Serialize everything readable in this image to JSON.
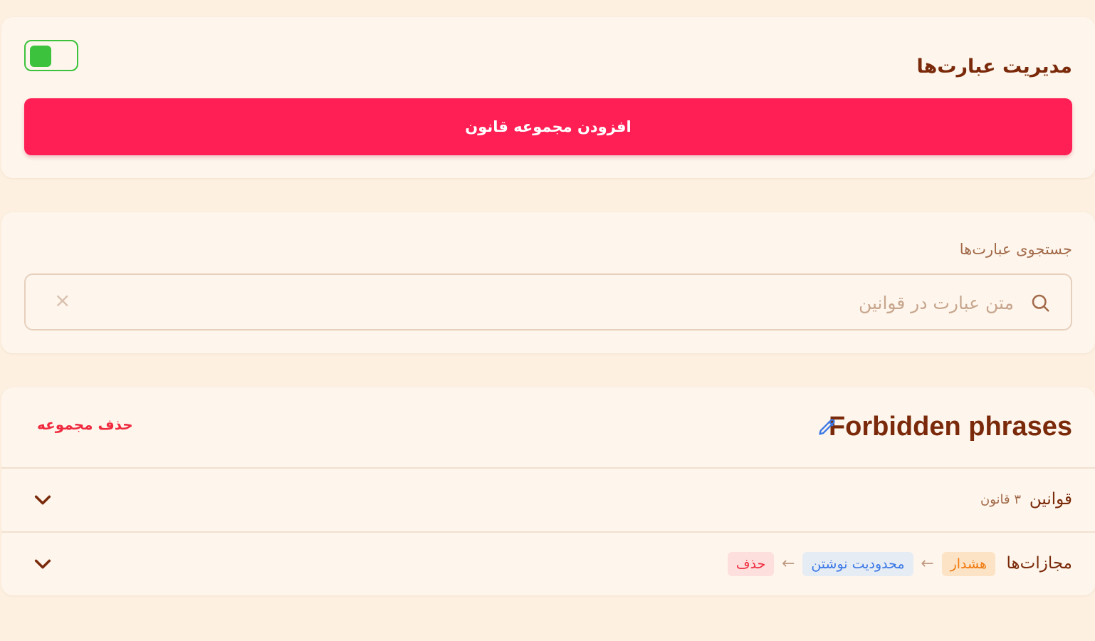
{
  "header": {
    "title": "مدیریت عبارت‌ها",
    "toggle_on": true,
    "add_button_label": "افزودن مجموعه قانون"
  },
  "search": {
    "label": "جستجوی عبارت‌ها",
    "placeholder": "متن عبارت در قوانین",
    "value": ""
  },
  "rule_set": {
    "name": "Forbidden phrases",
    "delete_label": "حذف مجموعه",
    "rules_row": {
      "label": "قوانین",
      "count_text": "۳ قانون"
    },
    "penalties_row": {
      "label": "مجازات‌ها",
      "steps": [
        {
          "label": "هشدار",
          "kind": "warning"
        },
        {
          "label": "محدودیت نوشتن",
          "kind": "restrict"
        },
        {
          "label": "حذف",
          "kind": "delete"
        }
      ]
    }
  },
  "colors": {
    "background": "#fdf0e1",
    "card": "#fef6ec",
    "accent": "#ff1f55",
    "toggle_on": "#3cc23c",
    "title": "#7a2a0a",
    "danger": "#ef2a3f",
    "warning": "#f07a10",
    "info": "#3b78e6"
  }
}
